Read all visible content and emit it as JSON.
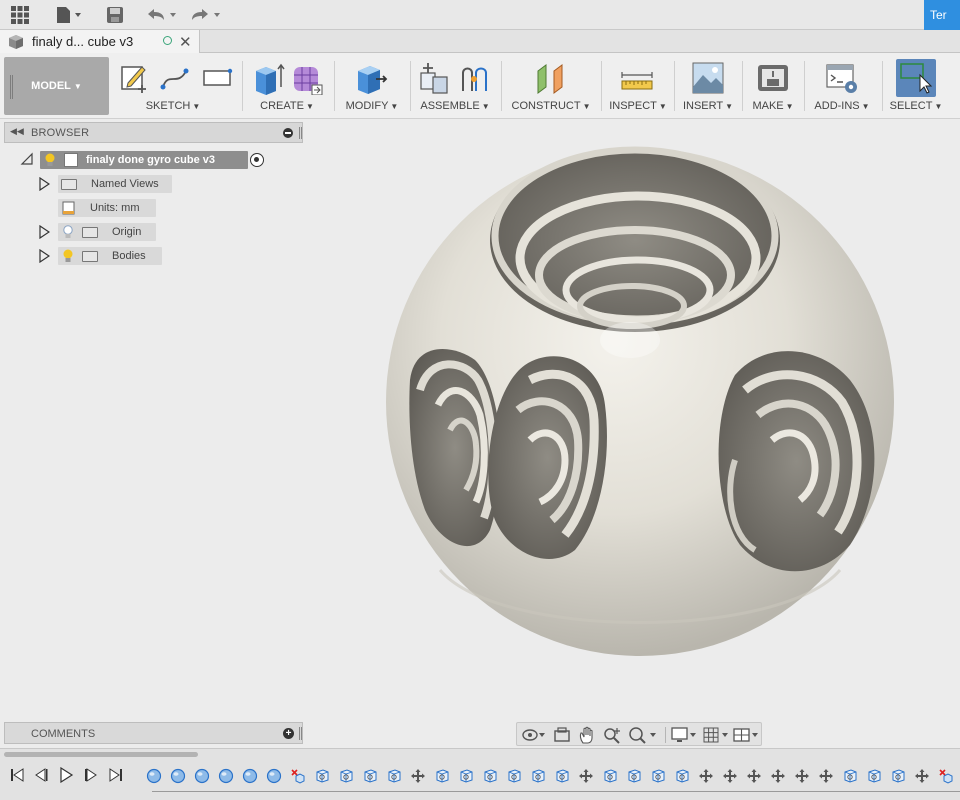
{
  "app": {
    "user_chip": "Ter"
  },
  "document": {
    "tab_title": "finaly d... cube v3"
  },
  "toolbar": {
    "workspace": "MODEL",
    "groups": [
      {
        "label": "SKETCH"
      },
      {
        "label": "CREATE"
      },
      {
        "label": "MODIFY"
      },
      {
        "label": "ASSEMBLE"
      },
      {
        "label": "CONSTRUCT"
      },
      {
        "label": "INSPECT"
      },
      {
        "label": "INSERT"
      },
      {
        "label": "MAKE"
      },
      {
        "label": "ADD-INS"
      },
      {
        "label": "SELECT"
      }
    ]
  },
  "browser": {
    "title": "BROWSER",
    "root": "finaly done gyro cube v3",
    "items": [
      {
        "label": "Named Views"
      },
      {
        "label": "Units: mm"
      },
      {
        "label": "Origin"
      },
      {
        "label": "Bodies"
      }
    ]
  },
  "comments": {
    "title": "COMMENTS"
  },
  "colors": {
    "accent": "#2f8fe0",
    "select_active": "#5b86ba",
    "model_surface": "#e4e1d8"
  },
  "timeline": {
    "features": [
      "sphere",
      "sphere",
      "sphere",
      "sphere",
      "sphere",
      "sphere",
      "sketch-deleted",
      "body",
      "body",
      "body",
      "body",
      "move",
      "body",
      "body",
      "body",
      "body",
      "body",
      "body",
      "move",
      "body",
      "body",
      "body",
      "body",
      "move",
      "move",
      "move",
      "move",
      "move",
      "move",
      "body",
      "body",
      "body",
      "move",
      "body-deleted",
      "move",
      "body"
    ]
  }
}
